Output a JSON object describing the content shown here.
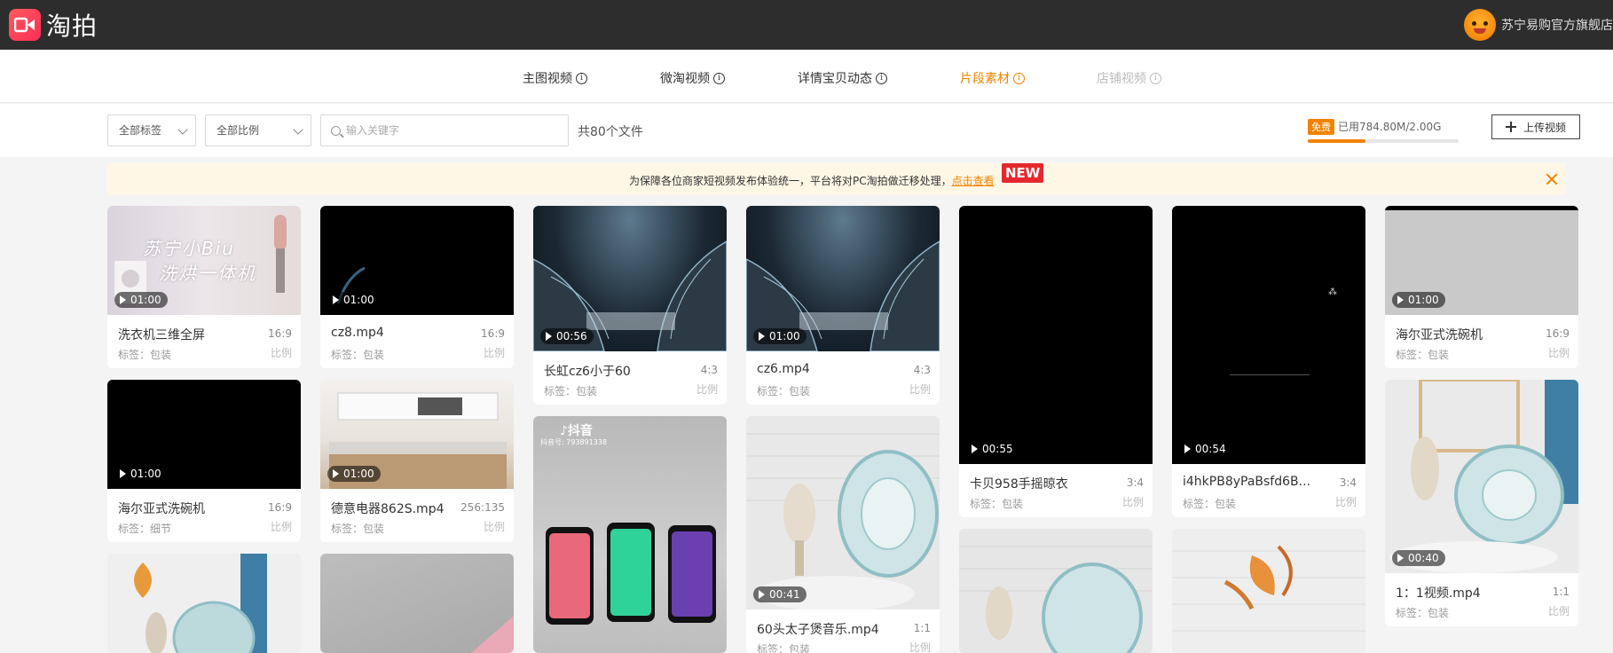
{
  "header": {
    "app_name": "淘拍",
    "shop_name": "苏宁易购官方旗舰店"
  },
  "tabs": [
    {
      "label": "主图视频",
      "state": "normal"
    },
    {
      "label": "微淘视频",
      "state": "normal"
    },
    {
      "label": "详情宝贝动态",
      "state": "normal"
    },
    {
      "label": "片段素材",
      "state": "active"
    },
    {
      "label": "店铺视频",
      "state": "disabled"
    }
  ],
  "filters": {
    "tag_select": "全部标签",
    "ratio_select": "全部比例",
    "search_placeholder": "输入关键字",
    "search_value": "",
    "file_count": "共80个文件"
  },
  "storage": {
    "badge": "免费",
    "used_text": "已用784.80M/2.00G",
    "used_fraction": 0.383
  },
  "upload": {
    "label": "上传视频"
  },
  "notice": {
    "text": "为保障各位商家短视频发布体验统一，平台将对PC淘拍做迁移处理，",
    "link": "点击查看",
    "badge": "NEW"
  },
  "ratio_label": "比例",
  "videos": [
    {
      "title": "洗衣机三维全屏",
      "tag": "标签：包装",
      "ratio": "16:9",
      "duration": "01:00"
    },
    {
      "title": "海尔亚式洗碗机",
      "tag": "标签：细节",
      "ratio": "16:9",
      "duration": "01:00"
    },
    {
      "title": "",
      "tag": "",
      "ratio": "",
      "duration": ""
    },
    {
      "title": "cz8.mp4",
      "tag": "标签：包装",
      "ratio": "16:9",
      "duration": "01:00"
    },
    {
      "title": "德意电器862S.mp4",
      "tag": "标签：包装",
      "ratio": "256:135",
      "duration": "01:00"
    },
    {
      "title": "",
      "tag": "",
      "ratio": "",
      "duration": ""
    },
    {
      "title": "长虹cz6小于60",
      "tag": "标签：包装",
      "ratio": "4:3",
      "duration": "00:56"
    },
    {
      "title": "",
      "tag": "",
      "ratio": "",
      "duration": "",
      "overlay_brand": "抖音",
      "overlay_id": "抖音号: 793891338"
    },
    {
      "title": "cz6.mp4",
      "tag": "标签：包装",
      "ratio": "4:3",
      "duration": "01:00"
    },
    {
      "title": "60头太子煲音乐.mp4",
      "tag": "标签：包装",
      "ratio": "1:1",
      "duration": "00:41"
    },
    {
      "title": "卡贝958手摇晾衣",
      "tag": "标签：包装",
      "ratio": "3:4",
      "duration": "00:55"
    },
    {
      "title": "",
      "tag": "",
      "ratio": "",
      "duration": ""
    },
    {
      "title": "i4hkPB8yPaBsfd6B...",
      "tag": "标签：包装",
      "ratio": "3:4",
      "duration": "00:54"
    },
    {
      "title": "",
      "tag": "",
      "ratio": "",
      "duration": ""
    },
    {
      "title": "海尔亚式洗碗机",
      "tag": "标签：包装",
      "ratio": "16:9",
      "duration": "01:00"
    },
    {
      "title": "1：1视频.mp4",
      "tag": "标签：包装",
      "ratio": "1:1",
      "duration": "00:40"
    }
  ],
  "thumbnail_text": {
    "laundry_line1": "苏宁小Biu",
    "laundry_line2": "洗烘一体机"
  }
}
